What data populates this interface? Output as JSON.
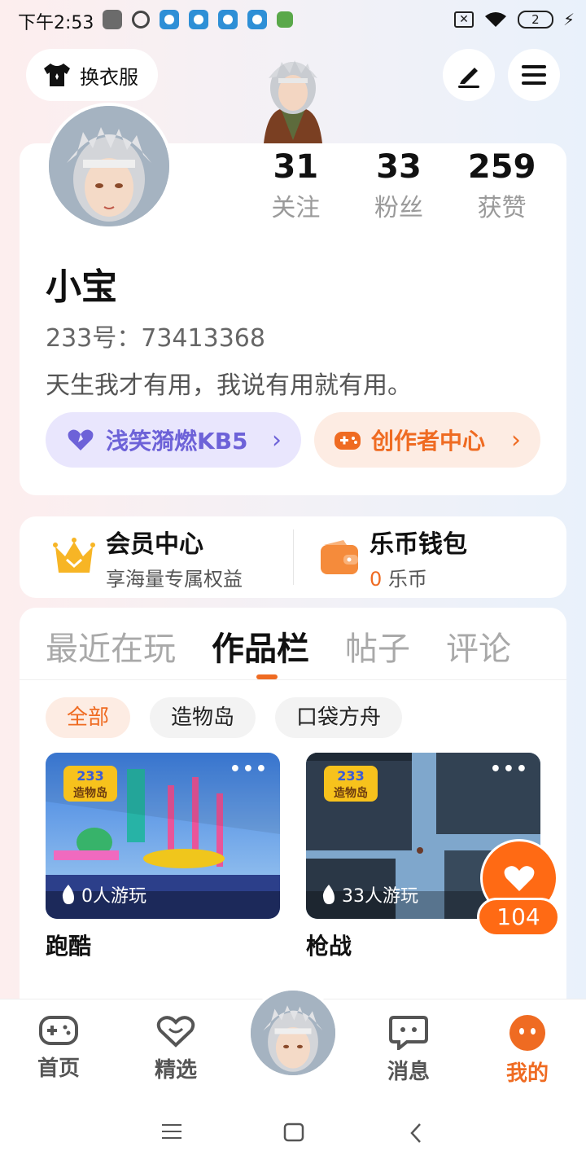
{
  "status_bar": {
    "time": "下午2:53",
    "battery": "2"
  },
  "header": {
    "outfit_label": "换衣服"
  },
  "profile": {
    "stats": [
      {
        "value": "31",
        "label": "关注"
      },
      {
        "value": "33",
        "label": "粉丝"
      },
      {
        "value": "259",
        "label": "获赞"
      }
    ],
    "name": "小宝",
    "id_text": "233号：73413368",
    "bio": "天生我才有用，我说有用就有用。",
    "level_label": "浅笑漪燃KB5",
    "creator_label": "创作者中心"
  },
  "membership": {
    "vip_title": "会员中心",
    "vip_subtitle": "享海量专属权益",
    "wallet_title": "乐币钱包",
    "wallet_amount": "0",
    "wallet_unit": "乐币"
  },
  "tabs": [
    "最近在玩",
    "作品栏",
    "帖子",
    "评论"
  ],
  "active_tab": "作品栏",
  "filters": [
    "全部",
    "造物岛",
    "口袋方舟"
  ],
  "works": [
    {
      "title": "跑酷",
      "plays": "0人游玩",
      "badge": "233",
      "badge_sub": "造物岛"
    },
    {
      "title": "枪战",
      "plays": "33人游玩",
      "badge": "233",
      "badge_sub": "造物岛"
    }
  ],
  "like_float": {
    "count": "104"
  },
  "bottom_nav": [
    {
      "label": "首页",
      "icon": "gamepad-icon"
    },
    {
      "label": "精选",
      "icon": "heart-bubble-icon"
    },
    {
      "label": "消息",
      "icon": "chat-icon"
    },
    {
      "label": "我的",
      "icon": "face-icon"
    }
  ],
  "colors": {
    "accent": "#ef6b22",
    "level": "#6d62d8",
    "like": "#ff6a14"
  }
}
